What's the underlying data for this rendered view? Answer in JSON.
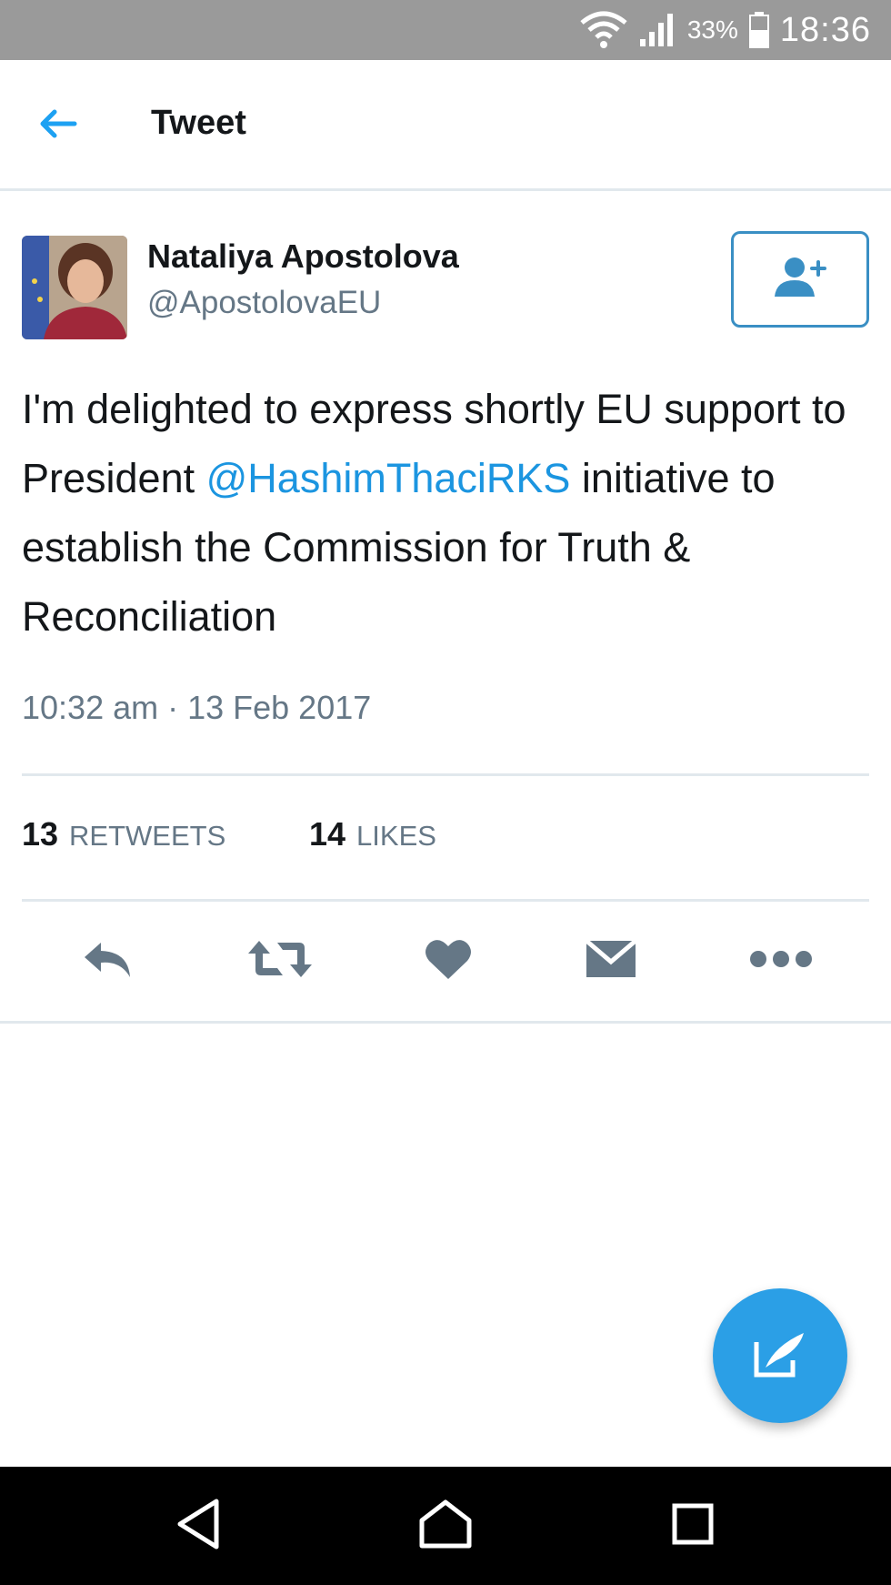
{
  "status_bar": {
    "battery_percent": "33%",
    "time": "18:36",
    "icons": [
      "wifi-icon",
      "signal-icon",
      "battery-icon"
    ]
  },
  "header": {
    "title": "Tweet",
    "back_icon": "back-arrow-icon"
  },
  "tweet": {
    "author": {
      "display_name": "Nataliya Apostolova",
      "handle": "@ApostolovaEU"
    },
    "text_before_mention": "I'm delighted to express shortly EU support to President ",
    "mention": "@HashimThaciRKS",
    "text_after_mention": " initiative to establish the Commission for Truth & Reconciliation",
    "timestamp": "10:32 am · 13 Feb 2017",
    "stats": {
      "retweets_count": "13",
      "retweets_label": "RETWEETS",
      "likes_count": "14",
      "likes_label": "LIKES"
    },
    "actions": [
      "reply-icon",
      "retweet-icon",
      "like-icon",
      "direct-message-icon",
      "more-icon"
    ]
  },
  "fab": {
    "icon": "compose-tweet-icon"
  },
  "nav_bar": {
    "icons": [
      "nav-back-icon",
      "nav-home-icon",
      "nav-recents-icon"
    ]
  },
  "colors": {
    "accent": "#1da1f2",
    "mention": "#1b95e0",
    "icon_gray": "#657786",
    "fab": "#2b9fe6",
    "status_bar": "#9a9a9a"
  }
}
